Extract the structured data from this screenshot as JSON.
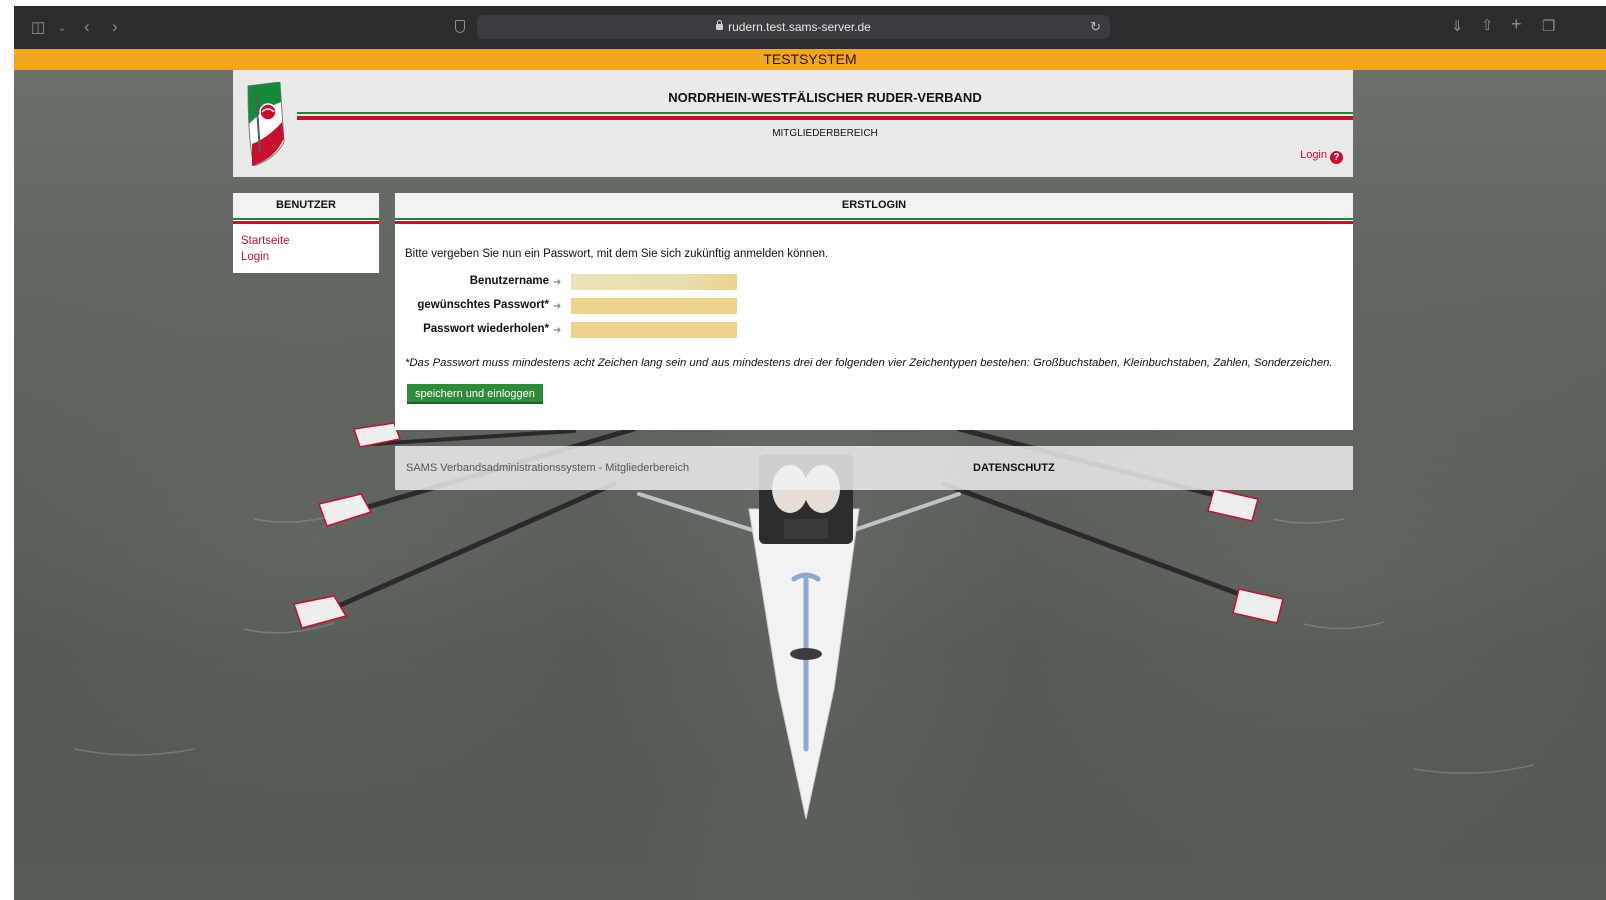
{
  "browser": {
    "url": "rudern.test.sams-server.de"
  },
  "testbar": {
    "label": "TESTSYSTEM"
  },
  "header": {
    "title": "NORDRHEIN-WESTFÄLISCHER RUDER-VERBAND",
    "subtitle": "MITGLIEDERBEREICH",
    "login_label": "Login",
    "help_glyph": "?"
  },
  "sidebar": {
    "title": "BENUTZER",
    "items": [
      {
        "label": "Startseite"
      },
      {
        "label": "Login"
      }
    ]
  },
  "main": {
    "title": "ERSTLOGIN",
    "intro": "Bitte vergeben Sie nun ein Passwort, mit dem Sie sich zukünftig anmelden können.",
    "fields": [
      {
        "label": "Benutzername",
        "value": ""
      },
      {
        "label": "gewünschtes Passwort*",
        "value": ""
      },
      {
        "label": "Passwort wiederholen*",
        "value": ""
      }
    ],
    "note": "*Das Passwort muss mindestens acht Zeichen lang sein und aus mindestens drei der folgenden vier Zeichentypen bestehen: Großbuchstaben, Kleinbuchstaben, Zahlen, Sonderzeichen.",
    "submit_label": "speichern und einloggen"
  },
  "footer": {
    "text": "SAMS Verbandsadministrationssystem - Mitgliederbereich",
    "link": "DATENSCHUTZ"
  },
  "colors": {
    "accent_red": "#c8102e",
    "accent_green": "#138a36",
    "testbar": "#f3a51d",
    "input_fill": "#ecd38a",
    "button": "#2e8b3a"
  }
}
